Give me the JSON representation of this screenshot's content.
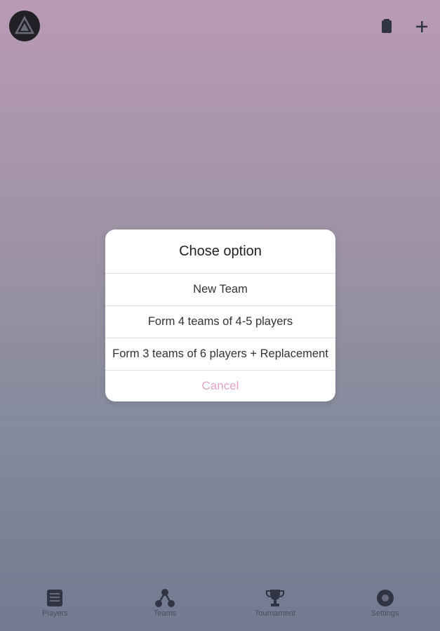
{
  "colors": {
    "accent": "#e3a3c9",
    "icon": "#2e3242"
  },
  "header": {
    "logo_icon": "app-logo-icon",
    "icons": [
      "document-icon",
      "plus-icon"
    ]
  },
  "dialog": {
    "title": "Chose option",
    "options": [
      {
        "label": "New Team"
      },
      {
        "label": "Form 4 teams of 4-5 players"
      },
      {
        "label": "Form 3 teams of 6 players + Replacement"
      }
    ],
    "cancel_label": "Cancel"
  },
  "tabbar": {
    "tabs": [
      {
        "label": "Players",
        "icon": "players-list-icon"
      },
      {
        "label": "Teams",
        "icon": "teams-icon"
      },
      {
        "label": "Tournament",
        "icon": "trophy-icon"
      },
      {
        "label": "Settings",
        "icon": "gear-icon"
      }
    ]
  }
}
